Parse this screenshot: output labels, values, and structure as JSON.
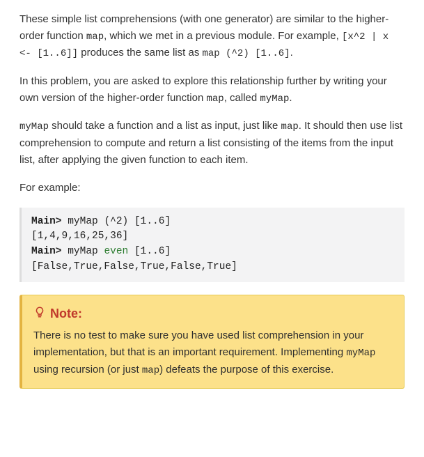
{
  "para1": {
    "segments": [
      {
        "text": "These simple list comprehensions (with one generator) are similar to the higher-order function "
      },
      {
        "text": "map",
        "cls": "kw-pink",
        "mono": true
      },
      {
        "text": ", which we met in a previous module. For example, "
      },
      {
        "text": "[x^2 | x ",
        "mono": true
      },
      {
        "text": "<-",
        "cls": "kw-orange",
        "mono": true
      },
      {
        "text": " [",
        "mono": true
      },
      {
        "text": "1",
        "cls": "kw-orange",
        "mono": true
      },
      {
        "text": "..",
        "cls": "kw-green",
        "mono": true
      },
      {
        "text": "6",
        "cls": "kw-orange",
        "mono": true
      },
      {
        "text": "]]",
        "mono": true
      },
      {
        "text": " produces the same list as "
      },
      {
        "text": "map",
        "cls": "kw-pink",
        "mono": true
      },
      {
        "text": " (^",
        "mono": true
      },
      {
        "text": "2",
        "cls": "kw-orange",
        "mono": true
      },
      {
        "text": ") [",
        "mono": true
      },
      {
        "text": "1",
        "cls": "kw-orange",
        "mono": true
      },
      {
        "text": "..",
        "cls": "kw-green",
        "mono": true
      },
      {
        "text": "6",
        "cls": "kw-orange",
        "mono": true
      },
      {
        "text": "]",
        "mono": true
      },
      {
        "text": "."
      }
    ]
  },
  "para2": {
    "segments": [
      {
        "text": "In this problem, you are asked to explore this relationship further by writing your own version of the higher-order function "
      },
      {
        "text": "map",
        "cls": "kw-pink",
        "mono": true
      },
      {
        "text": ", called "
      },
      {
        "text": "myMap",
        "mono": true
      },
      {
        "text": "."
      }
    ]
  },
  "para3": {
    "segments": [
      {
        "text": "myMap",
        "mono": true
      },
      {
        "text": " should take a function and a list as input, just like "
      },
      {
        "text": "map",
        "cls": "kw-pink",
        "mono": true
      },
      {
        "text": ". It should then use list comprehension to compute and return a list consisting of the items from the input list, after applying the given function to each item."
      }
    ]
  },
  "para4": {
    "text": "For example:"
  },
  "example": {
    "lines": [
      [
        {
          "text": "Main> ",
          "cls": "tok-prompt"
        },
        {
          "text": "myMap "
        },
        {
          "text": "(^2) "
        },
        {
          "text": "[1..6]"
        }
      ],
      [
        {
          "text": "[1,4,9,16,25,36]"
        }
      ],
      [
        {
          "text": "Main> ",
          "cls": "tok-prompt"
        },
        {
          "text": "myMap "
        },
        {
          "text": "even ",
          "cls": "tok-kw"
        },
        {
          "text": "[1..6]"
        }
      ],
      [
        {
          "text": "[False,True,False,True,False,True]"
        }
      ]
    ]
  },
  "note": {
    "icon": "bulb-icon",
    "heading": "Note:",
    "body_segments": [
      {
        "text": "There is no test to make sure you have used list comprehension in your implementation, but that is an important requirement. Implementing "
      },
      {
        "text": "myMap",
        "mono": true
      },
      {
        "text": " using recursion (or just "
      },
      {
        "text": "map",
        "cls": "kw-pink",
        "mono": true
      },
      {
        "text": ") defeats the purpose of this exercise."
      }
    ]
  }
}
